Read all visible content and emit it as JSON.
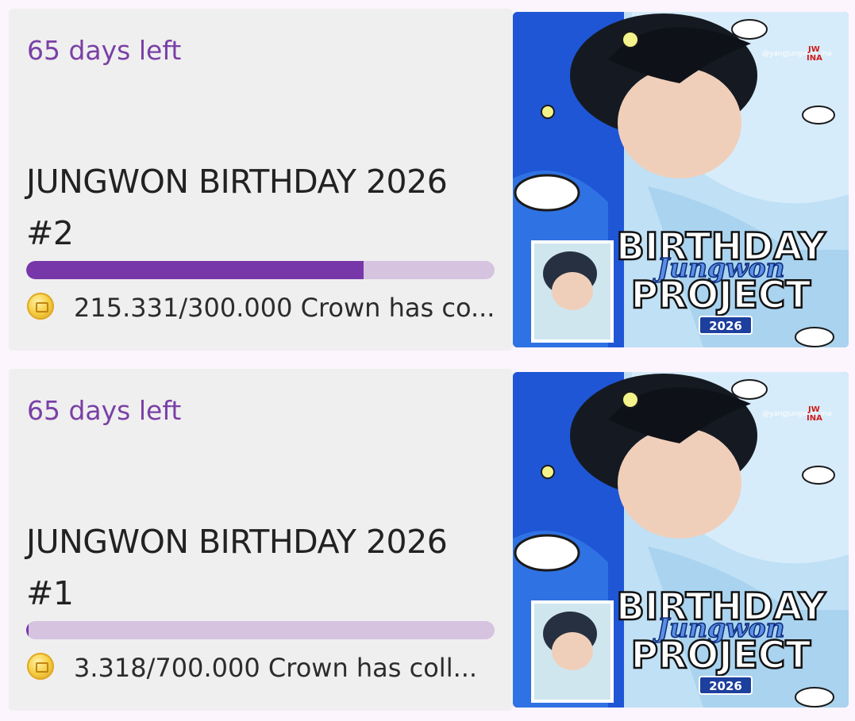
{
  "colors": {
    "accent": "#7737a9",
    "days_text": "#7a40a6",
    "track": "#d6c3e0",
    "card_bg": "#efefef",
    "page_bg": "#fcf5fd"
  },
  "campaigns": [
    {
      "days_left": "65 days left",
      "title": "JUNGWON BIRTHDAY 2026 #2",
      "progress_fraction": 0.72,
      "collected_text": "215.331/300.000 Crown has co...",
      "coin_icon": "crown-coin-icon",
      "image": {
        "handle": "@yangjungwon_ina",
        "tag_line1": "JW",
        "tag_line2": "INA",
        "line1": "BIRTHDAY",
        "line2": "Jungwon",
        "line3": "PROJECT",
        "year": "2026"
      }
    },
    {
      "days_left": "65 days left",
      "title": "JUNGWON BIRTHDAY 2026 #1",
      "progress_fraction": 0.005,
      "collected_text": "3.318/700.000 Crown has coll...",
      "coin_icon": "crown-coin-icon",
      "image": {
        "handle": "@yangjungwon_ina",
        "tag_line1": "JW",
        "tag_line2": "INA",
        "line1": "BIRTHDAY",
        "line2": "Jungwon",
        "line3": "PROJECT",
        "year": "2026"
      }
    }
  ]
}
